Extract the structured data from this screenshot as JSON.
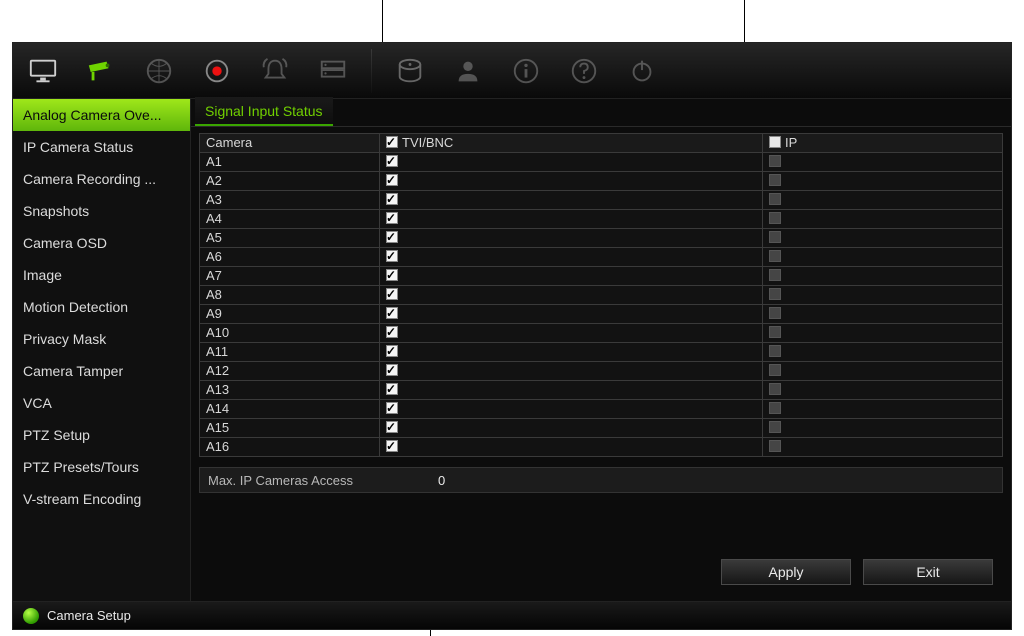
{
  "toolbar": {
    "icons": [
      "monitor",
      "camera",
      "grid",
      "record",
      "alarm",
      "hdd-group",
      "disk",
      "user",
      "info",
      "help",
      "power"
    ]
  },
  "sidebar": {
    "items": [
      {
        "label": "Analog Camera Ove...",
        "active": true
      },
      {
        "label": "IP Camera Status"
      },
      {
        "label": "Camera Recording ..."
      },
      {
        "label": "Snapshots"
      },
      {
        "label": "Camera OSD"
      },
      {
        "label": "Image"
      },
      {
        "label": "Motion Detection"
      },
      {
        "label": "Privacy Mask"
      },
      {
        "label": "Camera Tamper"
      },
      {
        "label": "VCA"
      },
      {
        "label": "PTZ Setup"
      },
      {
        "label": "PTZ Presets/Tours"
      },
      {
        "label": "V-stream Encoding"
      }
    ]
  },
  "tab": {
    "label": "Signal Input Status"
  },
  "table": {
    "headers": {
      "camera": "Camera",
      "tvi": "TVI/BNC",
      "ip": "IP"
    },
    "header_checks": {
      "tvi": true,
      "ip": false
    },
    "rows": [
      {
        "camera": "A1",
        "tvi": true,
        "ip": false
      },
      {
        "camera": "A2",
        "tvi": true,
        "ip": false
      },
      {
        "camera": "A3",
        "tvi": true,
        "ip": false
      },
      {
        "camera": "A4",
        "tvi": true,
        "ip": false
      },
      {
        "camera": "A5",
        "tvi": true,
        "ip": false
      },
      {
        "camera": "A6",
        "tvi": true,
        "ip": false
      },
      {
        "camera": "A7",
        "tvi": true,
        "ip": false
      },
      {
        "camera": "A8",
        "tvi": true,
        "ip": false
      },
      {
        "camera": "A9",
        "tvi": true,
        "ip": false
      },
      {
        "camera": "A10",
        "tvi": true,
        "ip": false
      },
      {
        "camera": "A11",
        "tvi": true,
        "ip": false
      },
      {
        "camera": "A12",
        "tvi": true,
        "ip": false
      },
      {
        "camera": "A13",
        "tvi": true,
        "ip": false
      },
      {
        "camera": "A14",
        "tvi": true,
        "ip": false
      },
      {
        "camera": "A15",
        "tvi": true,
        "ip": false
      },
      {
        "camera": "A16",
        "tvi": true,
        "ip": false
      }
    ]
  },
  "max_ip": {
    "label": "Max. IP Cameras Access",
    "value": "0"
  },
  "buttons": {
    "apply": "Apply",
    "exit": "Exit"
  },
  "footer": {
    "label": "Camera Setup"
  },
  "colors": {
    "accent": "#71d000",
    "accent_fill": "#7ed321",
    "bg": "#0c0c0c"
  }
}
